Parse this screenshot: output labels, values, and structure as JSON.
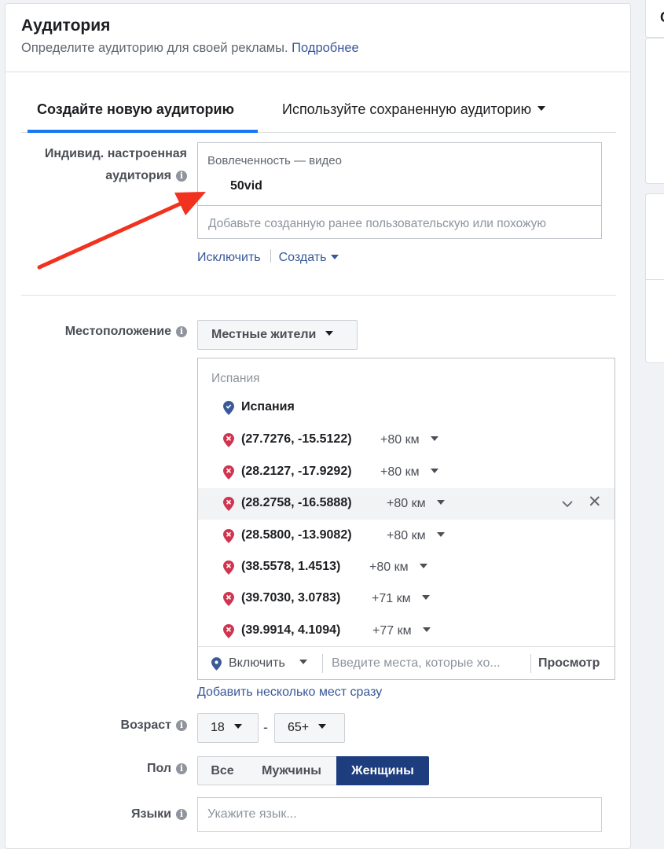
{
  "header": {
    "title": "Аудитория",
    "subtitle": "Определите аудиторию для своей рекламы.",
    "more_link": "Подробнее"
  },
  "tabs": {
    "new_audience": "Создайте новую аудиторию",
    "saved_audience": "Используйте сохраненную аудиторию"
  },
  "custom_audience": {
    "label_line1": "Индивид. настроенная",
    "label_line2": "аудитория",
    "category": "Вовлеченность — видео",
    "item": "50vid",
    "placeholder": "Добавьте созданную ранее пользовательскую или похожую",
    "exclude_link": "Исключить",
    "create_link": "Создать"
  },
  "location": {
    "label": "Местоположение",
    "type_button": "Местные жители",
    "country_header": "Испания",
    "country": "Испания",
    "items": [
      {
        "coords": "(27.7276, -15.5122)",
        "radius": "+80 км"
      },
      {
        "coords": "(28.2127, -17.9292)",
        "radius": "+80 км"
      },
      {
        "coords": "(28.2758, -16.5888)",
        "radius": "+80 км"
      },
      {
        "coords": "(28.5800, -13.9082)",
        "radius": "+80 км"
      },
      {
        "coords": "(38.5578, 1.4513)",
        "radius": "+80 км"
      },
      {
        "coords": "(39.7030, 3.0783)",
        "radius": "+71 км"
      },
      {
        "coords": "(39.9914, 4.1094)",
        "radius": "+77 км"
      }
    ],
    "include_label": "Включить",
    "search_placeholder": "Введите места, которые хо...",
    "preview_button": "Просмотр",
    "bulk_add_link": "Добавить несколько мест сразу"
  },
  "age": {
    "label": "Возраст",
    "min": "18",
    "dash": "-",
    "max": "65+"
  },
  "gender": {
    "label": "Пол",
    "options": [
      "Все",
      "Мужчины",
      "Женщины"
    ],
    "selected": "Женщины"
  },
  "languages": {
    "label": "Языки",
    "placeholder": "Укажите язык..."
  },
  "icons": {
    "info": "info-icon",
    "included_pin": "blue-location-pin-icon",
    "excluded_pin": "red-location-pin-x-icon",
    "annotation": "red-arrow-annotation"
  },
  "colors": {
    "link": "#385898",
    "tab_underline": "#1877f2",
    "selected_segment": "#1d3d7e",
    "excluded_pin": "#d0344f",
    "included_pin": "#3b5998",
    "annotation_arrow": "#f0321e"
  }
}
